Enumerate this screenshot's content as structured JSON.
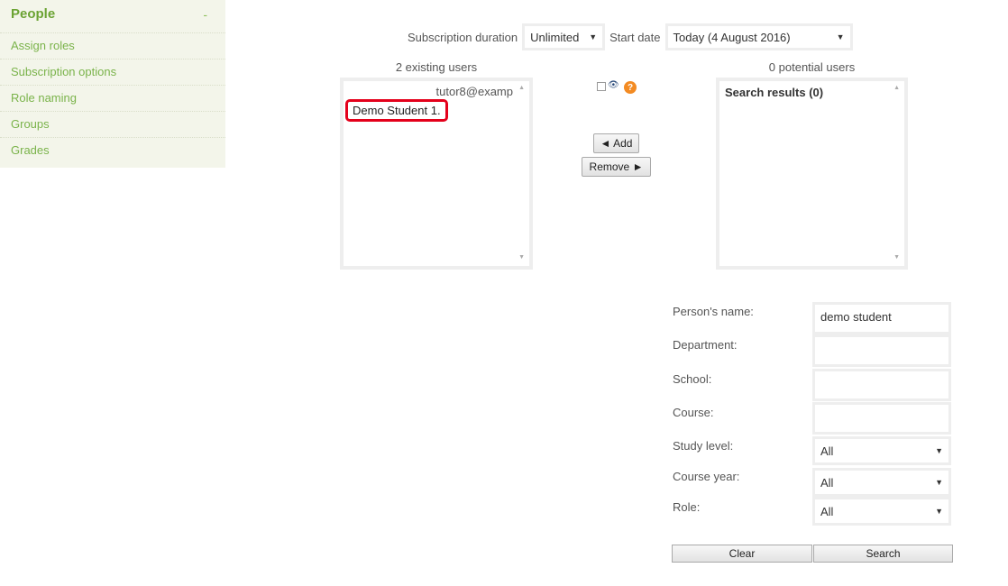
{
  "sidebar": {
    "title": "People",
    "collapse_symbol": "-",
    "items": [
      {
        "label": "Assign roles"
      },
      {
        "label": "Subscription options"
      },
      {
        "label": "Role naming"
      },
      {
        "label": "Groups"
      },
      {
        "label": "Grades"
      }
    ]
  },
  "subscription": {
    "duration_label": "Subscription duration",
    "duration_value": "Unlimited",
    "start_label": "Start date",
    "start_value": "Today (4 August 2016)"
  },
  "existing_users": {
    "label": "2 existing users",
    "header_entry": "tutor8@examp",
    "selected_entry": "Demo Student 1."
  },
  "potential_users": {
    "label": "0 potential users",
    "results_label": "Search results (0)"
  },
  "actions": {
    "add_label": "◄ Add",
    "remove_label": "Remove ►"
  },
  "filters": {
    "persons_name_label": "Person's name:",
    "persons_name_value": "demo student",
    "department_label": "Department:",
    "department_value": "",
    "school_label": "School:",
    "school_value": "",
    "course_label": "Course:",
    "course_value": "",
    "study_level_label": "Study level:",
    "study_level_value": "All",
    "course_year_label": "Course year:",
    "course_year_value": "All",
    "role_label": "Role:",
    "role_value": "All",
    "clear_label": "Clear",
    "search_label": "Search"
  },
  "colors": {
    "accent_green": "#6ba333",
    "highlight_red": "#e4001b"
  }
}
